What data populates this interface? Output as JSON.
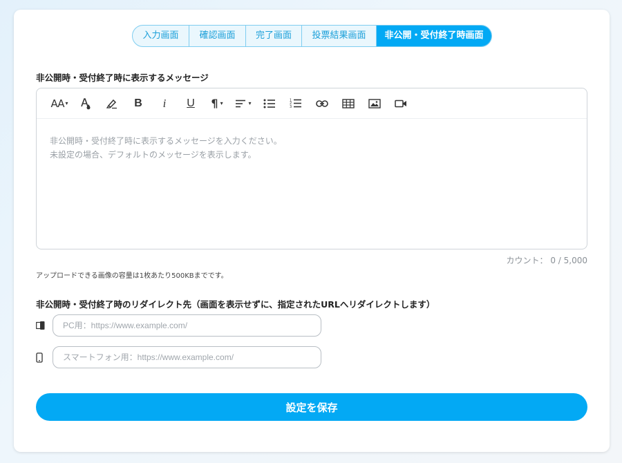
{
  "tabs": [
    {
      "label": "入力画面",
      "active": false
    },
    {
      "label": "確認画面",
      "active": false
    },
    {
      "label": "完了画面",
      "active": false
    },
    {
      "label": "投票結果画面",
      "active": false
    },
    {
      "label": "非公開・受付終了時画面",
      "active": true
    }
  ],
  "message_section": {
    "label": "非公開時・受付終了時に表示するメッセージ",
    "placeholder_line1": "非公開時・受付終了時に表示するメッセージを入力ください。",
    "placeholder_line2": "未設定の場合、デフォルトのメッセージを表示します。",
    "count_text": "カウント： 0 / 5,000",
    "upload_note": "アップロードできる画像の容量は1枚あたり500KBまでです。"
  },
  "toolbar": {
    "font_size_glyph": "AA",
    "bold_glyph": "B",
    "italic_glyph": "i",
    "underline_glyph": "U",
    "paragraph_glyph": "¶",
    "icons": [
      "font-size-icon",
      "text-color-icon",
      "highlight-icon",
      "bold-icon",
      "italic-icon",
      "underline-icon",
      "paragraph-icon",
      "align-icon",
      "bullet-list-icon",
      "numbered-list-icon",
      "link-icon",
      "table-icon",
      "image-icon",
      "video-icon"
    ]
  },
  "redirect_section": {
    "label": "非公開時・受付終了時のリダイレクト先（画面を表示せずに、指定されたURLへリダイレクトします）",
    "pc_placeholder": "PC用：https://www.example.com/",
    "pc_value": "",
    "sp_placeholder": "スマートフォン用：https://www.example.com/",
    "sp_value": ""
  },
  "save_label": "設定を保存",
  "colors": {
    "accent": "#03a9f4",
    "tab_border": "#7ecdf0"
  }
}
